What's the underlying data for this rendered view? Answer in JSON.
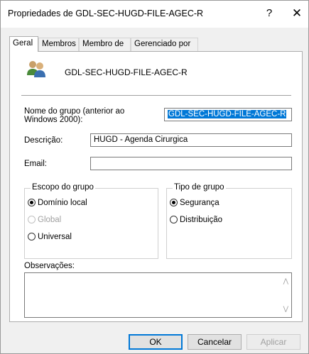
{
  "window": {
    "title": "Propriedades de GDL-SEC-HUGD-FILE-AGEC-R",
    "help_glyph": "?",
    "close_glyph": "✕"
  },
  "tabs": [
    {
      "label": "Geral",
      "active": true
    },
    {
      "label": "Membros",
      "active": false
    },
    {
      "label": "Membro de",
      "active": false
    },
    {
      "label": "Gerenciado por",
      "active": false
    }
  ],
  "general": {
    "icon": "group-users-icon",
    "group_name": "GDL-SEC-HUGD-FILE-AGEC-R",
    "pre2000_label_line1": "Nome do grupo (anterior ao",
    "pre2000_label_line2": "Windows 2000):",
    "pre2000_value": "GDL-SEC-HUGD-FILE-AGEC-R",
    "description_label": "Descrição:",
    "description_value": "HUGD - Agenda Cirurgica",
    "email_label": "Email:",
    "email_value": "",
    "scope": {
      "title": "Escopo do grupo",
      "options": [
        {
          "label": "Domínio local",
          "selected": true,
          "disabled": false
        },
        {
          "label": "Global",
          "selected": false,
          "disabled": true
        },
        {
          "label": "Universal",
          "selected": false,
          "disabled": false
        }
      ]
    },
    "type": {
      "title": "Tipo de grupo",
      "options": [
        {
          "label": "Segurança",
          "selected": true
        },
        {
          "label": "Distribuição",
          "selected": false
        }
      ]
    },
    "notes_label": "Observações:",
    "notes_value": ""
  },
  "buttons": {
    "ok": "OK",
    "cancel": "Cancelar",
    "apply": "Aplicar"
  },
  "colors": {
    "selection": "#0078d7",
    "window_bg": "#f0f0f0",
    "disabled_text": "#a0a0a0"
  }
}
